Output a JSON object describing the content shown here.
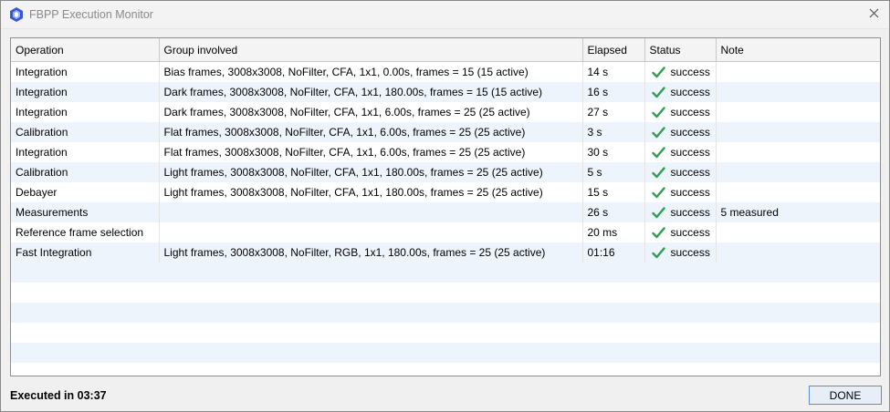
{
  "window": {
    "title": "FBPP Execution Monitor",
    "icons": {
      "app": "fbpp-app-icon",
      "close": "close-icon"
    }
  },
  "table": {
    "columns": [
      "Operation",
      "Group involved",
      "Elapsed",
      "Status",
      "Note"
    ],
    "rows": [
      {
        "operation": "Integration",
        "group": "Bias frames, 3008x3008, NoFilter, CFA, 1x1, 0.00s, frames = 15 (15 active)",
        "elapsed": "14 s",
        "status": "success",
        "note": ""
      },
      {
        "operation": "Integration",
        "group": "Dark frames, 3008x3008, NoFilter, CFA, 1x1, 180.00s, frames = 15 (15 active)",
        "elapsed": "16 s",
        "status": "success",
        "note": ""
      },
      {
        "operation": "Integration",
        "group": "Dark frames, 3008x3008, NoFilter, CFA, 1x1, 6.00s, frames = 25 (25 active)",
        "elapsed": "27 s",
        "status": "success",
        "note": ""
      },
      {
        "operation": "Calibration",
        "group": "Flat frames, 3008x3008, NoFilter, CFA, 1x1, 6.00s, frames = 25 (25 active)",
        "elapsed": "3 s",
        "status": "success",
        "note": ""
      },
      {
        "operation": "Integration",
        "group": "Flat frames, 3008x3008, NoFilter, CFA, 1x1, 6.00s, frames = 25 (25 active)",
        "elapsed": "30 s",
        "status": "success",
        "note": ""
      },
      {
        "operation": "Calibration",
        "group": "Light frames, 3008x3008, NoFilter, CFA, 1x1, 180.00s, frames = 25 (25 active)",
        "elapsed": "5 s",
        "status": "success",
        "note": ""
      },
      {
        "operation": "Debayer",
        "group": "Light frames, 3008x3008, NoFilter, CFA, 1x1, 180.00s, frames = 25 (25 active)",
        "elapsed": "15 s",
        "status": "success",
        "note": ""
      },
      {
        "operation": "Measurements",
        "group": "",
        "elapsed": "26 s",
        "status": "success",
        "note": "5 measured"
      },
      {
        "operation": "Reference frame selection",
        "group": "",
        "elapsed": "20 ms",
        "status": "success",
        "note": ""
      },
      {
        "operation": "Fast Integration",
        "group": "Light frames, 3008x3008, NoFilter, RGB, 1x1, 180.00s, frames = 25 (25 active)",
        "elapsed": "01:16",
        "status": "success",
        "note": ""
      }
    ],
    "status_icon": "checkmark-icon",
    "colors": {
      "check": "#2e9e4f",
      "alt_row": "#eef4fc"
    }
  },
  "footer": {
    "executed": "Executed in 03:37",
    "done_label": "DONE"
  }
}
